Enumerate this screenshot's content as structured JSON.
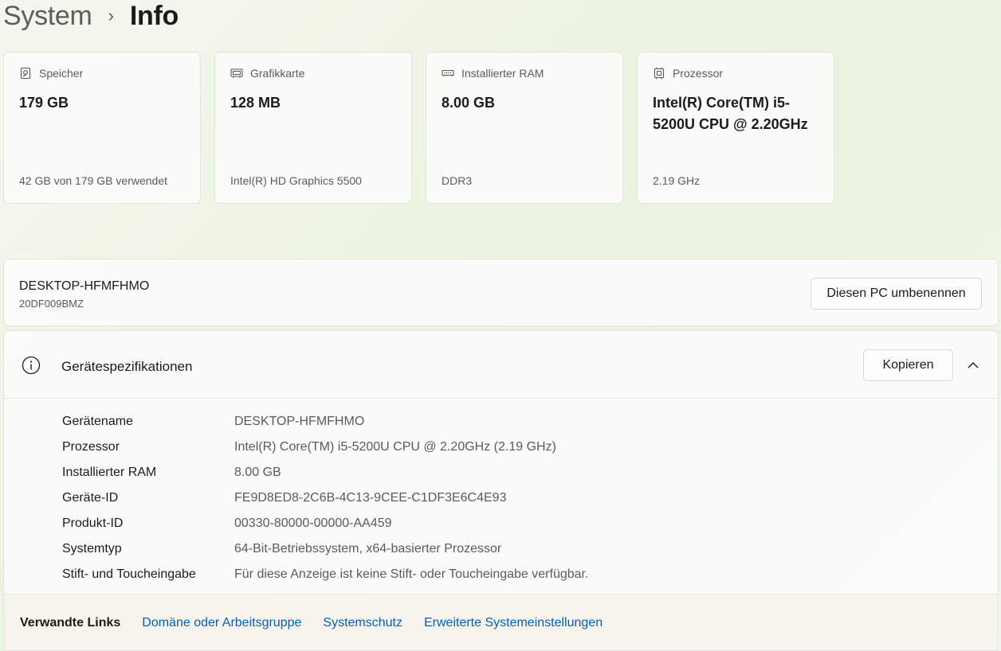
{
  "breadcrumb": {
    "parent": "System",
    "separator": "›",
    "current": "Info"
  },
  "cards": [
    {
      "icon": "storage-icon",
      "label": "Speicher",
      "value": "179 GB",
      "sub": "42 GB von 179 GB verwendet"
    },
    {
      "icon": "graphics-card-icon",
      "label": "Grafikkarte",
      "value": "128 MB",
      "sub": "Intel(R) HD Graphics 5500"
    },
    {
      "icon": "ram-icon",
      "label": "Installierter RAM",
      "value": "8.00 GB",
      "sub": "DDR3"
    },
    {
      "icon": "processor-icon",
      "label": "Prozessor",
      "value": "Intel(R) Core(TM) i5-5200U CPU @ 2.20GHz",
      "sub": "2.19 GHz"
    }
  ],
  "device": {
    "name": "DESKTOP-HFMFHMO",
    "model": "20DF009BMZ",
    "rename_label": "Diesen PC umbenennen"
  },
  "specs": {
    "icon": "info-icon",
    "title": "Gerätespezifikationen",
    "copy_label": "Kopieren",
    "rows": [
      {
        "key": "Gerätename",
        "value": "DESKTOP-HFMFHMO"
      },
      {
        "key": "Prozessor",
        "value": "Intel(R) Core(TM) i5-5200U CPU @ 2.20GHz (2.19 GHz)"
      },
      {
        "key": "Installierter RAM",
        "value": "8.00 GB"
      },
      {
        "key": "Geräte-ID",
        "value": "FE9D8ED8-2C6B-4C13-9CEE-C1DF3E6C4E93"
      },
      {
        "key": "Produkt-ID",
        "value": "00330-80000-00000-AA459"
      },
      {
        "key": "Systemtyp",
        "value": "64-Bit-Betriebssystem, x64-basierter Prozessor"
      },
      {
        "key": "Stift- und Toucheingabe",
        "value": "Für diese Anzeige ist keine Stift- oder Toucheingabe verfügbar."
      }
    ]
  },
  "related_links": {
    "title": "Verwandte Links",
    "links": [
      "Domäne oder Arbeitsgruppe",
      "Systemschutz",
      "Erweiterte Systemeinstellungen"
    ]
  },
  "colors": {
    "link": "#0b5cad",
    "accent_bg": "#e9f3df"
  }
}
